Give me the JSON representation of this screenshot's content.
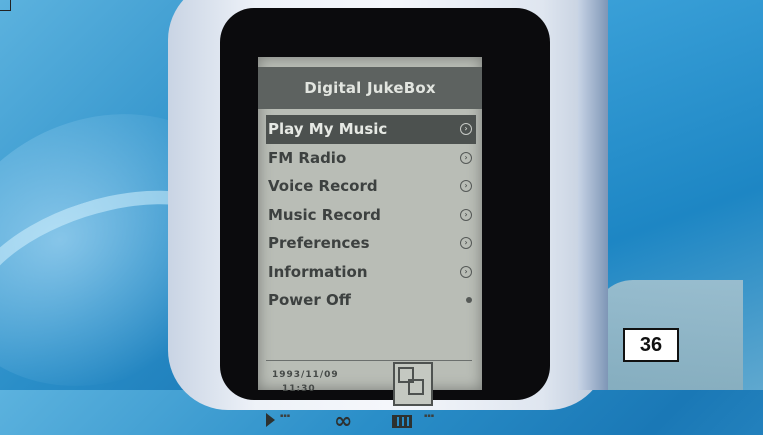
{
  "screen": {
    "title": "Digital JukeBox",
    "menu": [
      {
        "label": "Play My Music",
        "selected": true
      },
      {
        "label": "FM Radio",
        "selected": false
      },
      {
        "label": "Voice Record",
        "selected": false
      },
      {
        "label": "Music Record",
        "selected": false
      },
      {
        "label": "Preferences",
        "selected": false
      },
      {
        "label": "Information",
        "selected": false
      },
      {
        "label": "Power Off",
        "selected": false
      }
    ],
    "date": "1993/11/09",
    "time": "11:30",
    "status_icons": [
      "play-icon",
      "repeat-icon",
      "battery-icon"
    ]
  },
  "page_number": "36",
  "colors": {
    "background": "#2a8ec8",
    "lcd": "#b9bdb6",
    "selected_row": "#4c514f"
  }
}
